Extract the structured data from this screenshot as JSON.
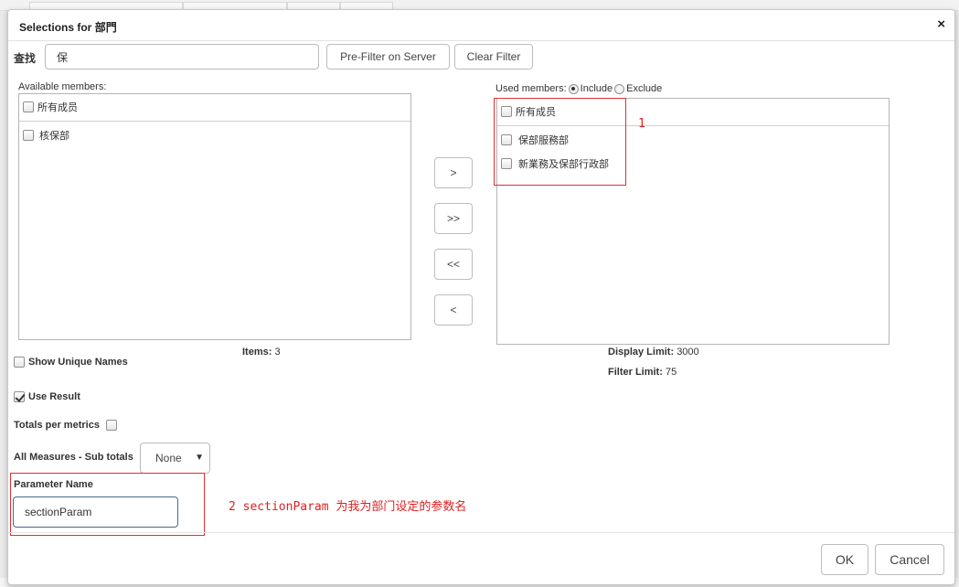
{
  "dialog": {
    "title": "Selections for 部門",
    "close_glyph": "×"
  },
  "search": {
    "label": "查找",
    "value": "保"
  },
  "buttons": {
    "prefilter": "Pre-Filter on Server",
    "clear_filter": "Clear Filter",
    "move_right": ">",
    "move_all_right": ">>",
    "move_all_left": "<<",
    "move_left": "<",
    "ok": "OK",
    "cancel": "Cancel"
  },
  "available": {
    "label": "Available members:",
    "header": "所有成员",
    "items": [
      "核保部"
    ],
    "count_label": "Items:",
    "count_value": "3"
  },
  "used": {
    "label": "Used members:",
    "include_label": "Include",
    "exclude_label": "Exclude",
    "mode": "include",
    "header": "所有成员",
    "items": [
      "保部服務部",
      "新業務及保部行政部"
    ],
    "display_limit_label": "Display Limit:",
    "display_limit_value": "3000",
    "filter_limit_label": "Filter Limit:",
    "filter_limit_value": "75"
  },
  "options": {
    "show_unique_names": {
      "label": "Show Unique Names",
      "checked": false
    },
    "use_result": {
      "label": "Use Result",
      "checked": true
    },
    "totals_per_metrics": {
      "label": "Totals per metrics",
      "checked": false
    },
    "all_measures_label": "All Measures - Sub totals",
    "all_measures_value": "None"
  },
  "parameter": {
    "label": "Parameter Name",
    "value": "sectionParam"
  },
  "annotations": {
    "note1": "1",
    "note2": "2  sectionParam 为我为部门设定的参数名",
    "color": "#e02020"
  }
}
